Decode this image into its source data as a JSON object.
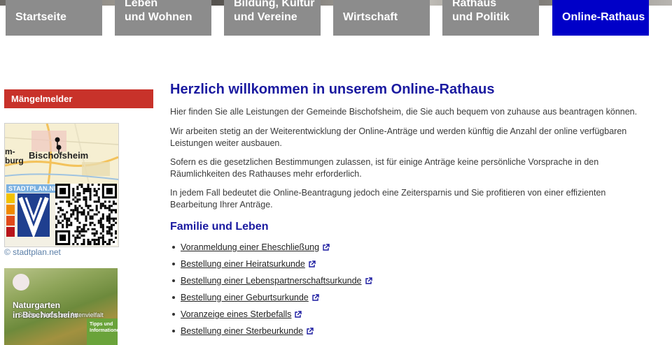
{
  "nav": {
    "tabs": [
      {
        "label": "Startseite",
        "active": false
      },
      {
        "label": "Leben\nund Wohnen",
        "active": false
      },
      {
        "label": "Bildung, Kultur\nund Vereine",
        "active": false
      },
      {
        "label": "Wirtschaft",
        "active": false
      },
      {
        "label": "Rathaus\nund Politik",
        "active": false
      },
      {
        "label": "Online-Rathaus",
        "active": true
      }
    ]
  },
  "sidebar": {
    "maengelmelder": "Mängelmelder",
    "map": {
      "city": "Bischofsheim",
      "left_label": "m-\nburg",
      "brand": "STADTPLAN.NET",
      "copyright": "© stadtplan.net"
    },
    "banner": {
      "title": "Naturgarten\nin Bischofsheim",
      "subtitle": "Schöne Natur und Artenvielfalt",
      "badge": "Tipps und\nInformationen"
    }
  },
  "main": {
    "title": "Herzlich willkommen in unserem Online-Rathaus",
    "paragraphs": [
      "Hier finden Sie alle Leistungen der Gemeinde Bischofsheim, die Sie auch bequem von zuhause aus beantragen können.",
      "Wir arbeiten stetig an der Weiterentwicklung der Online-Anträge und werden künftig die Anzahl der online verfügbaren Leistungen weiter ausbauen.",
      "Sofern es die gesetzlichen Bestimmungen zulassen, ist für einige Anträge keine persönliche Vorsprache in den Räumlichkeiten des Rathauses mehr erforderlich.",
      "In jedem Fall bedeutet die Online-Beantragung jedoch eine Zeitersparnis und Sie profitieren von einer effizienten Bearbeitung Ihrer Anträge."
    ],
    "section_title": "Familie und Leben",
    "links": [
      "Voranmeldung einer Eheschließung",
      "Bestellung einer Heiratsurkunde",
      "Bestellung einer Lebenspartnerschaftsurkunde",
      "Bestellung einer Geburtsurkunde",
      "Voranzeige eines Sterbefalls",
      "Bestellung einer Sterbeurkunde"
    ]
  },
  "colors": {
    "tab_gray": "#8c8c8c",
    "tab_active": "#0000c8",
    "heading_blue": "#1a1aa0",
    "alert_red": "#c8322a"
  },
  "icons": {
    "external_link": "external-link-icon",
    "map_pin": "map-pin-icon",
    "qr_code": "qr-code-icon"
  }
}
